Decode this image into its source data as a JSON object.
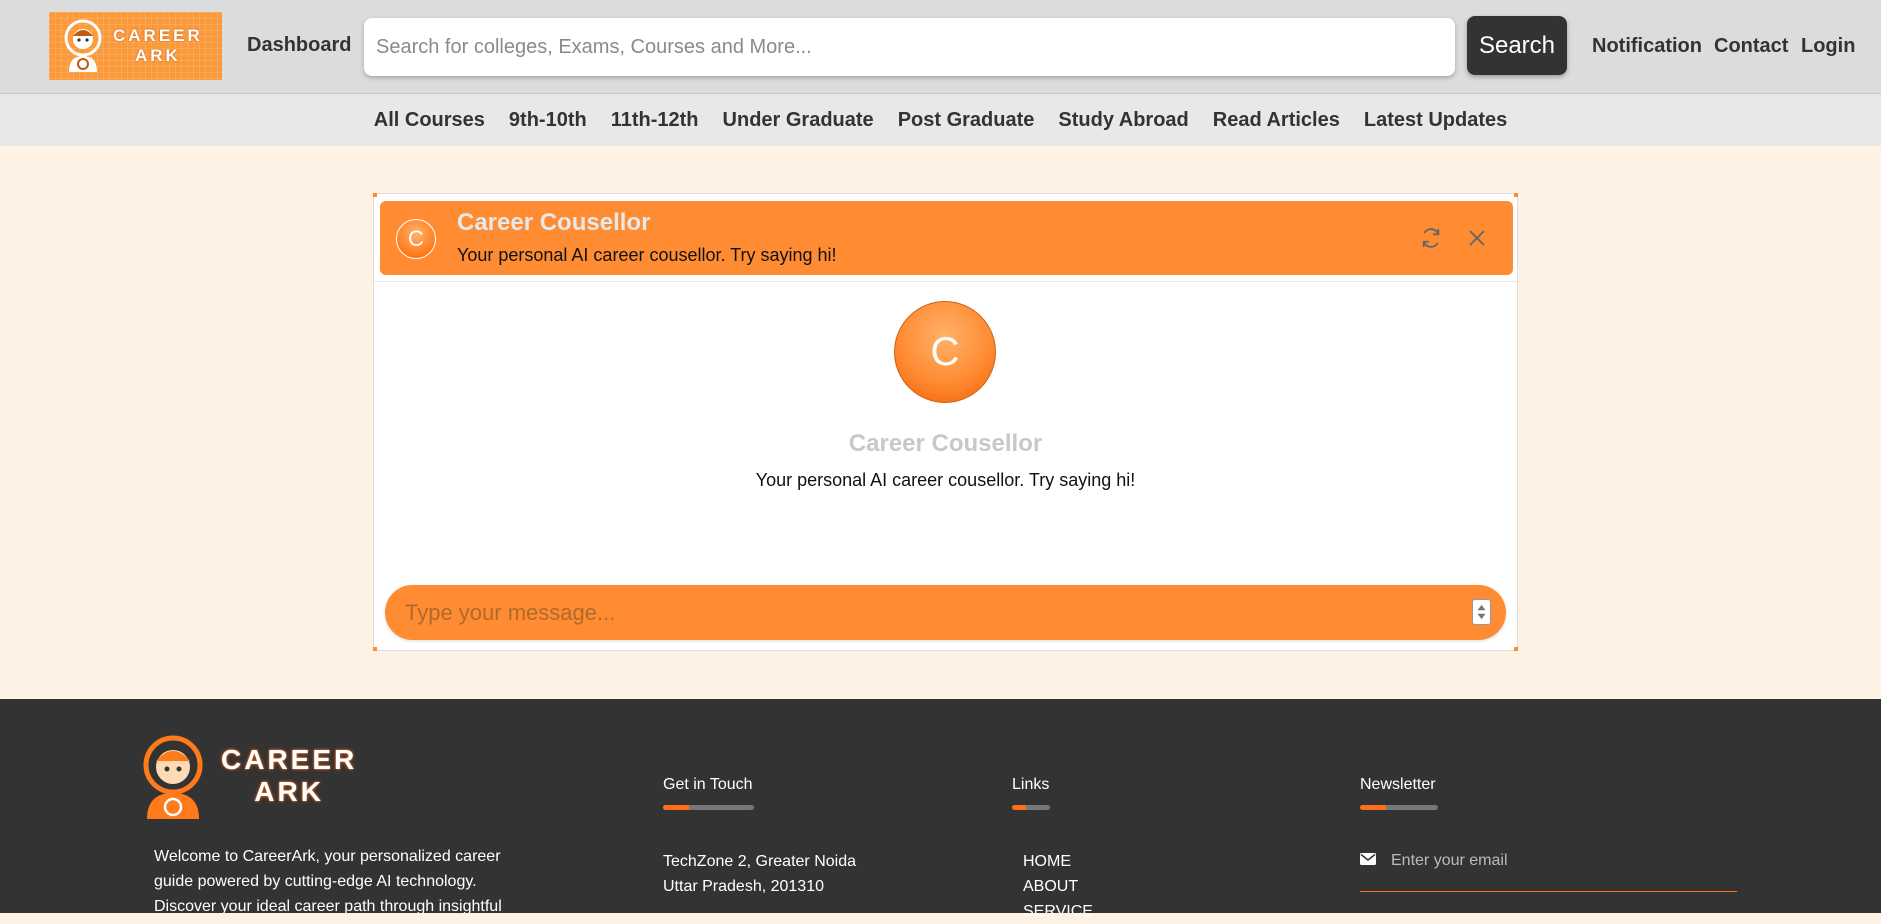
{
  "header": {
    "logo_text_line1": "CAREER",
    "logo_text_line2": "ARK",
    "dashboard": "Dashboard",
    "search_placeholder": "Search for colleges, Exams, Courses and More...",
    "search_button": "Search",
    "notification": "Notification",
    "contact": "Contact",
    "login": "Login"
  },
  "subnav": [
    "All Courses",
    "9th-10th",
    "11th-12th",
    "Under Graduate",
    "Post Graduate",
    "Study Abroad",
    "Read Articles",
    "Latest Updates"
  ],
  "chat": {
    "avatar_letter": "C",
    "title": "Career Cousellor",
    "subtitle": "Your personal AI career cousellor. Try saying hi!",
    "refresh_icon": "refresh-icon",
    "close_icon": "close-icon",
    "message_placeholder": "Type your message...",
    "accent_color": "#ff8c33"
  },
  "footer": {
    "logo_text_line1": "CAREER",
    "logo_text_line2": "ARK",
    "about": "Welcome to CareerArk, your personalized career guide powered by cutting-edge AI technology. Discover your ideal career path through insightful",
    "get_in_touch": {
      "heading": "Get in Touch",
      "line1": "TechZone 2, Greater Noida",
      "line2": "Uttar Pradesh, 201310"
    },
    "links": {
      "heading": "Links",
      "items": [
        "HOME",
        "ABOUT",
        "SERVICE"
      ]
    },
    "newsletter": {
      "heading": "Newsletter",
      "placeholder": "Enter your email",
      "icon": "envelope-icon"
    }
  }
}
